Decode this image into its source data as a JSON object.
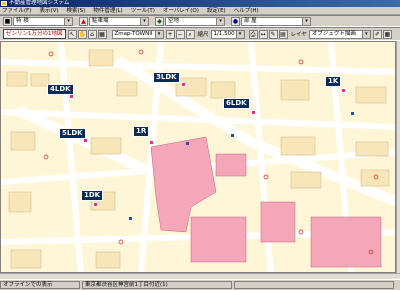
{
  "window": {
    "title": "不動産管理地図システム"
  },
  "menu": [
    "ファイル(F)",
    "表示(V)",
    "検索(S)",
    "物件管理(L)",
    "ツール(T)",
    "オーバレイ(O)",
    "設定(E)",
    "ヘルプ(H)"
  ],
  "toolbar1": {
    "left_combo": "特 積",
    "mid_combo": "駐車場",
    "right_combo": "空地",
    "far_combo": "部 屋"
  },
  "toolbar2": {
    "zoom_button": "ゼンリン1万分の1地図",
    "map_combo": "Zmap-TOWNII",
    "scale_label": "縮尺",
    "scale_value": "1/1,500",
    "layer_label": "レイヤ",
    "layer_value": "オブジェクト描画"
  },
  "status": {
    "left": "オフラインでの表示",
    "address": "東京都渋谷区神宮前1丁目付近(1)",
    "coord": ""
  },
  "poi_labels": [
    {
      "text": "3LDK"
    },
    {
      "text": "4LDK"
    },
    {
      "text": "1K"
    },
    {
      "text": "6LDK"
    },
    {
      "text": "5LDK"
    },
    {
      "text": "1R"
    },
    {
      "text": "1DK"
    }
  ],
  "colors": {
    "building_pink": "#f4a7b9",
    "building_beige": "#f8e6b8",
    "road": "#ffffff",
    "poi_bg": "#0a2a5a",
    "marker": "#e0308a"
  }
}
